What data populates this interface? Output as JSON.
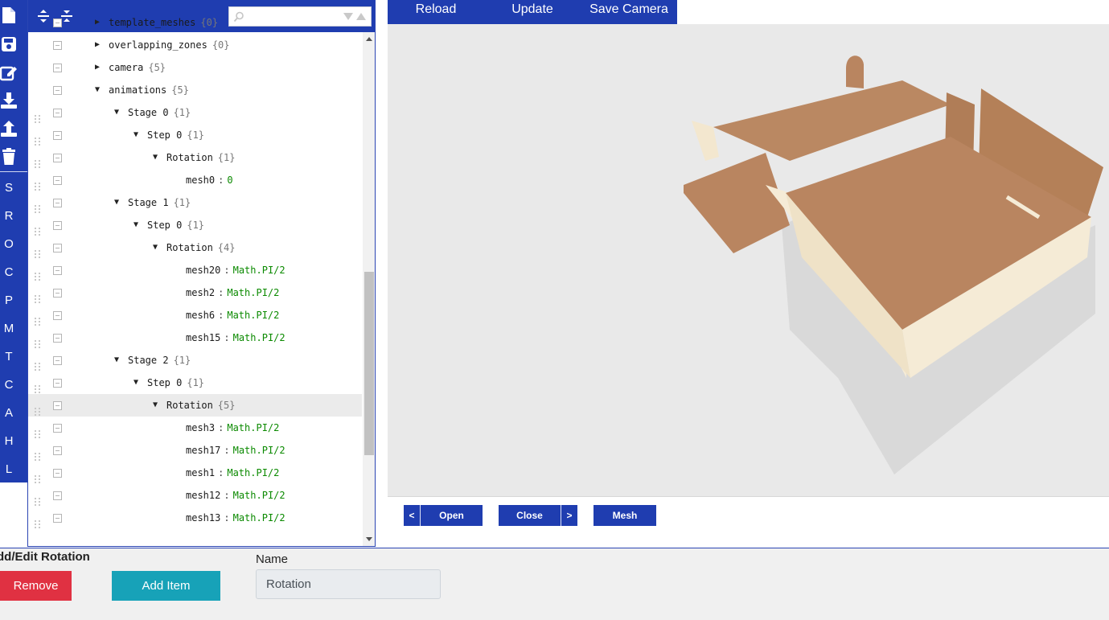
{
  "toolbar": {
    "icons": [
      "new-file-icon",
      "save-icon",
      "edit-icon",
      "download-icon",
      "upload-icon",
      "trash-icon"
    ],
    "letters": [
      "S",
      "R",
      "O",
      "C",
      "P",
      "M",
      "T",
      "C",
      "A",
      "H",
      "L"
    ]
  },
  "tree": {
    "header": {
      "expand_all_icon": "expand-all-icon",
      "collapse_all_icon": "collapse-all-icon",
      "search_value": ""
    },
    "rows": [
      {
        "key": "template_meshes",
        "count": "{0}",
        "value": "",
        "toggle": "▶",
        "selected": false
      },
      {
        "key": "overlapping_zones",
        "count": "{0}",
        "value": "",
        "toggle": "▶",
        "selected": false
      },
      {
        "key": "camera",
        "count": "{5}",
        "value": "",
        "toggle": "▶",
        "selected": false
      },
      {
        "key": "animations",
        "count": "{5}",
        "value": "",
        "toggle": "▼",
        "selected": false
      },
      {
        "key": "Stage 0",
        "count": "{1}",
        "value": "",
        "toggle": "▼",
        "selected": false
      },
      {
        "key": "Step 0",
        "count": "{1}",
        "value": "",
        "toggle": "▼",
        "selected": false
      },
      {
        "key": "Rotation",
        "count": "{1}",
        "value": "",
        "toggle": "▼",
        "selected": false
      },
      {
        "key": "mesh0",
        "count": "",
        "value": "0",
        "toggle": "",
        "selected": false
      },
      {
        "key": "Stage 1",
        "count": "{1}",
        "value": "",
        "toggle": "▼",
        "selected": false
      },
      {
        "key": "Step 0",
        "count": "{1}",
        "value": "",
        "toggle": "▼",
        "selected": false
      },
      {
        "key": "Rotation",
        "count": "{4}",
        "value": "",
        "toggle": "▼",
        "selected": false
      },
      {
        "key": "mesh20",
        "count": "",
        "value": "Math.PI/2",
        "toggle": "",
        "selected": false
      },
      {
        "key": "mesh2",
        "count": "",
        "value": "Math.PI/2",
        "toggle": "",
        "selected": false
      },
      {
        "key": "mesh6",
        "count": "",
        "value": "Math.PI/2",
        "toggle": "",
        "selected": false
      },
      {
        "key": "mesh15",
        "count": "",
        "value": "Math.PI/2",
        "toggle": "",
        "selected": false
      },
      {
        "key": "Stage 2",
        "count": "{1}",
        "value": "",
        "toggle": "▼",
        "selected": false
      },
      {
        "key": "Step 0",
        "count": "{1}",
        "value": "",
        "toggle": "▼",
        "selected": false
      },
      {
        "key": "Rotation",
        "count": "{5}",
        "value": "",
        "toggle": "▼",
        "selected": true
      },
      {
        "key": "mesh3",
        "count": "",
        "value": "Math.PI/2",
        "toggle": "",
        "selected": false
      },
      {
        "key": "mesh17",
        "count": "",
        "value": "Math.PI/2",
        "toggle": "",
        "selected": false
      },
      {
        "key": "mesh1",
        "count": "",
        "value": "Math.PI/2",
        "toggle": "",
        "selected": false
      },
      {
        "key": "mesh12",
        "count": "",
        "value": "Math.PI/2",
        "toggle": "",
        "selected": false
      },
      {
        "key": "mesh13",
        "count": "",
        "value": "Math.PI/2",
        "toggle": "",
        "selected": false
      }
    ]
  },
  "viewer": {
    "tabs": {
      "reload": "Reload",
      "update": "Update",
      "save_camera": "Save Camera"
    },
    "controls": {
      "prev": "<",
      "open": "Open",
      "close": "Close",
      "next": ">",
      "mesh": "Mesh"
    },
    "colors": {
      "cardboard": "#b98560",
      "cardboard_inner": "#f5ebd6",
      "background": "#e9e9e9"
    }
  },
  "editor": {
    "title": "dd/Edit Rotation",
    "remove_label": "Remove",
    "add_item_label": "Add Item",
    "name_label": "Name",
    "name_value": "Rotation"
  },
  "colors": {
    "primary": "#1f3db0",
    "danger": "#e03142",
    "info": "#17a2b8"
  }
}
